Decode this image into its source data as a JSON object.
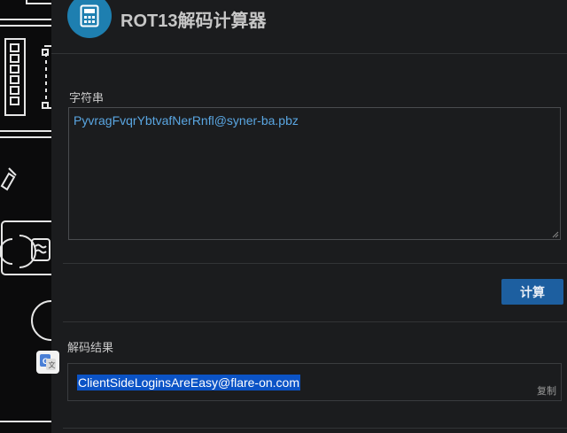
{
  "app": {
    "title": "ROT13解码计算器",
    "icon": "calculator-icon",
    "accent": "#1e7fb0"
  },
  "input": {
    "label": "字符串",
    "value": "PyvragFvqrYbtvafNerRnfl@syner-ba.pbz"
  },
  "actions": {
    "calculate_label": "计算",
    "button_color": "#1d5fa0"
  },
  "result": {
    "label": "解码结果",
    "value": "ClientSideLoginsAreEasy@flare-on.com",
    "copy_label": "复制",
    "highlight_color": "#0b53c6"
  },
  "sidebar": {
    "translate_icon": "google-translate-icon"
  }
}
